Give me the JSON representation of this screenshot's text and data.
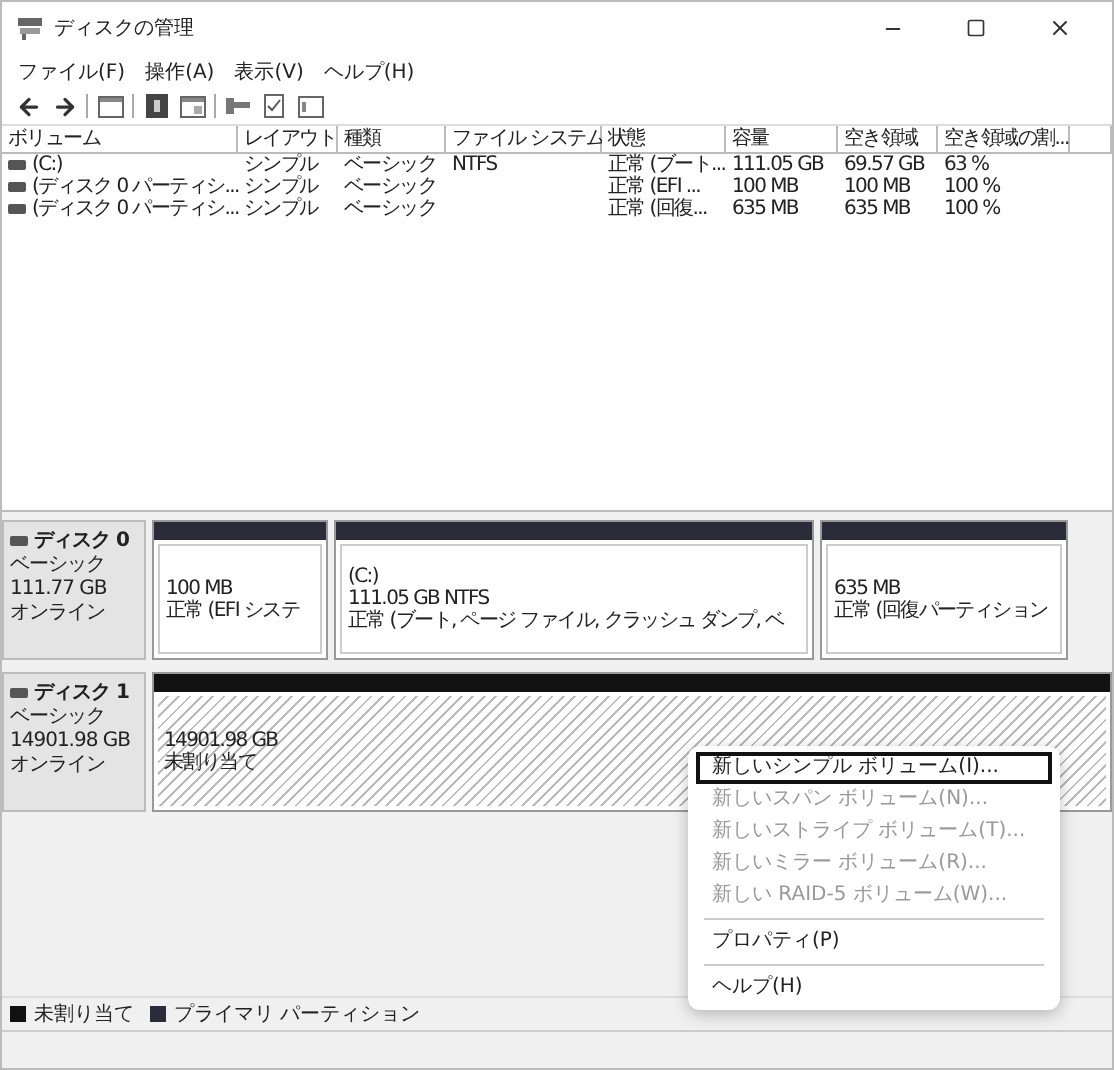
{
  "window": {
    "title": "ディスクの管理"
  },
  "menu": [
    "ファイル(F)",
    "操作(A)",
    "表示(V)",
    "ヘルプ(H)"
  ],
  "volume_table": {
    "columns": [
      "ボリューム",
      "レイアウト",
      "種類",
      "ファイル システム",
      "状態",
      "容量",
      "空き領域",
      "空き領域の割..."
    ],
    "rows": [
      [
        "(C:)",
        "シンプル",
        "ベーシック",
        "NTFS",
        "正常 (ブート...",
        "111.05 GB",
        "69.57 GB",
        "63 %"
      ],
      [
        "(ディスク 0 パーティシ...",
        "シンプル",
        "ベーシック",
        "",
        "正常 (EFI ...",
        "100 MB",
        "100 MB",
        "100 %"
      ],
      [
        "(ディスク 0 パーティシ...",
        "シンプル",
        "ベーシック",
        "",
        "正常 (回復...",
        "635 MB",
        "635 MB",
        "100 %"
      ]
    ]
  },
  "disks": [
    {
      "name": "ディスク 0",
      "type": "ベーシック",
      "size": "111.77 GB",
      "status": "オンライン",
      "partitions": [
        {
          "kind": "primary",
          "lines": [
            "100 MB",
            "正常 (EFI システ"
          ]
        },
        {
          "kind": "primary",
          "lines": [
            "(C:)",
            "111.05 GB NTFS",
            "正常 (ブート, ページ ファイル, クラッシュ ダンプ, ベ"
          ]
        },
        {
          "kind": "primary",
          "lines": [
            "635 MB",
            "正常 (回復パーティション"
          ]
        }
      ]
    },
    {
      "name": "ディスク 1",
      "type": "ベーシック",
      "size": "14901.98 GB",
      "status": "オンライン",
      "partitions": [
        {
          "kind": "unallocated",
          "lines": [
            "14901.98 GB",
            "未割り当て"
          ]
        }
      ]
    }
  ],
  "context_menu": [
    {
      "kind": "item",
      "label": "新しいシンプル ボリューム(I)...",
      "disabled": false,
      "selected": true
    },
    {
      "kind": "item",
      "label": "新しいスパン ボリューム(N)...",
      "disabled": true,
      "selected": false
    },
    {
      "kind": "item",
      "label": "新しいストライプ ボリューム(T)...",
      "disabled": true,
      "selected": false
    },
    {
      "kind": "item",
      "label": "新しいミラー ボリューム(R)...",
      "disabled": true,
      "selected": false
    },
    {
      "kind": "item",
      "label": "新しい RAID-5 ボリューム(W)...",
      "disabled": true,
      "selected": false
    },
    {
      "kind": "separator"
    },
    {
      "kind": "item",
      "label": "プロパティ(P)",
      "disabled": false,
      "selected": false
    },
    {
      "kind": "separator"
    },
    {
      "kind": "item",
      "label": "ヘルプ(H)",
      "disabled": false,
      "selected": false
    }
  ],
  "legend": [
    {
      "label": "未割り当て",
      "color": "#111111"
    },
    {
      "label": "プライマリ パーティション",
      "color": "#2b2b3a"
    }
  ]
}
